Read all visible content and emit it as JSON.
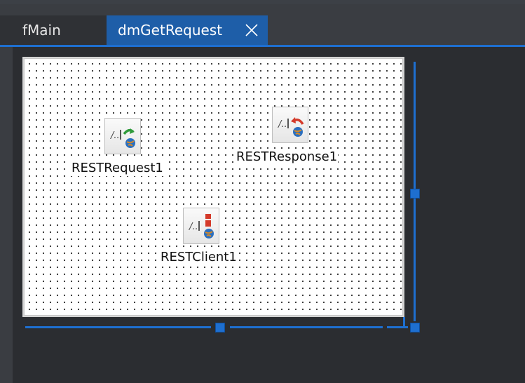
{
  "tabs": [
    {
      "label": "fMain",
      "active": false
    },
    {
      "label": "dmGetRequest",
      "active": true,
      "closable": true
    }
  ],
  "designer": {
    "components": [
      {
        "name": "RESTRequest1",
        "icon": "rest-request-icon"
      },
      {
        "name": "RESTResponse1",
        "icon": "rest-response-icon"
      },
      {
        "name": "RESTClient1",
        "icon": "rest-client-icon"
      }
    ]
  },
  "colors": {
    "accent": "#1e6fd0",
    "active_tab": "#1e5ea8",
    "background": "#2b2d31"
  }
}
